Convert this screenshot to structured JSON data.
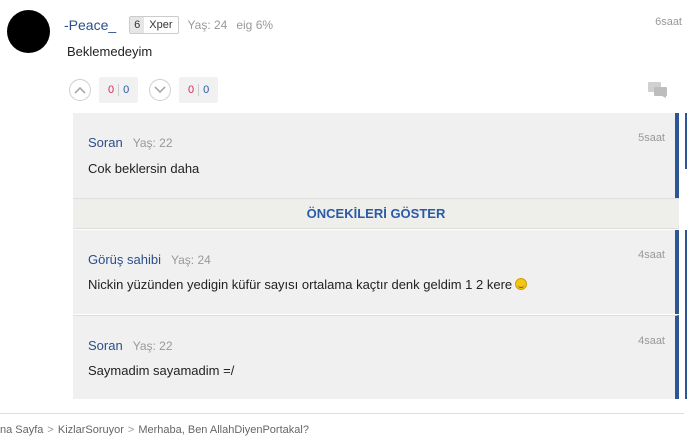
{
  "post": {
    "username": "-Peace_",
    "level": "6",
    "level_name": "Xper",
    "age": "Yaş: 24",
    "lean": "eig 6%",
    "time": "6saat",
    "text": "Beklemedeyim",
    "votes": {
      "up": {
        "red": "0",
        "blue": "0"
      },
      "down": {
        "red": "0",
        "blue": "0"
      }
    }
  },
  "replies": [
    {
      "name": "Soran",
      "age": "Yaş: 22",
      "time": "5saat",
      "text": "Cok beklersin daha"
    },
    {
      "name": "Görüş sahibi",
      "age": "Yaş: 24",
      "time": "4saat",
      "text": "Nickin yüzünden yedigin küfür sayısı ortalama kaçtır denk geldim 1 2 kere"
    },
    {
      "name": "Soran",
      "age": "Yaş: 22",
      "time": "4saat",
      "text": "Saymadim sayamadim =/"
    }
  ],
  "show_previous_label": "ÖNCEKİLERİ GÖSTER",
  "breadcrumb": [
    "na Sayfa",
    "KizlarSoruyor",
    "Merhaba, Ben AllahDiyenPortakal?"
  ],
  "colors": {
    "accent": "#2c5696",
    "link": "#2a5aa8",
    "vote_red": "#e0245e"
  }
}
